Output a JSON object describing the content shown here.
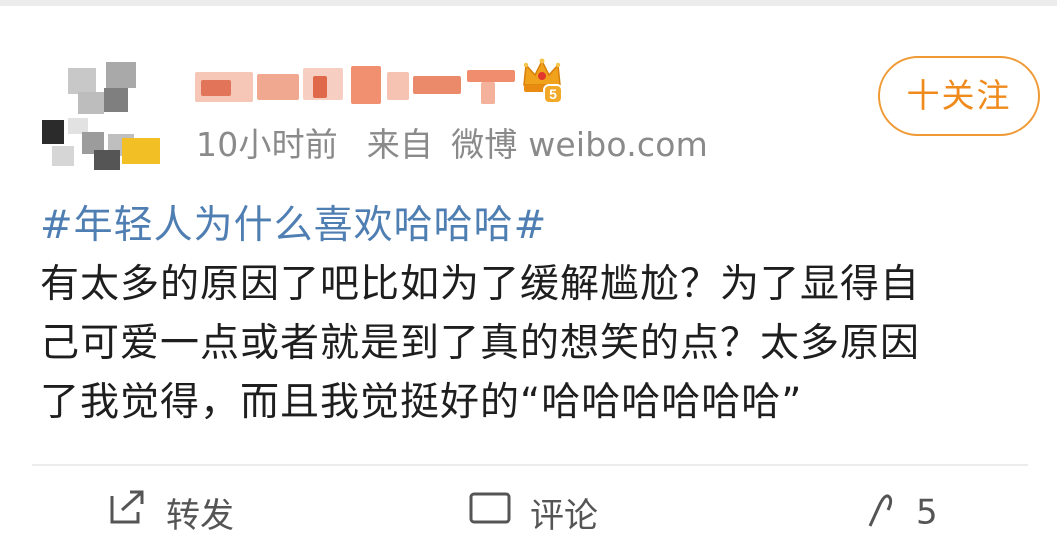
{
  "post": {
    "meta": {
      "time": "10小时前",
      "source_prefix": "来自",
      "source": "微博 weibo.com"
    },
    "follow_label": "十关注",
    "hashtag": "#年轻人为什么喜欢哈哈哈#",
    "body_lines": [
      "有太多的原因了吧比如为了缓解尴尬？为了显得自",
      "己可爱一点或者就是到了真的想笑的点？太多原因",
      "了我觉得，而且我觉挺好的“哈哈哈哈哈哈”"
    ]
  },
  "actions": {
    "repost_label": "转发",
    "comment_label": "评论",
    "like_count": "5"
  },
  "colors": {
    "accent_orange": "#ef8a1d",
    "hashtag_blue": "#4f7eb2",
    "meta_gray": "#8a8a8a"
  }
}
